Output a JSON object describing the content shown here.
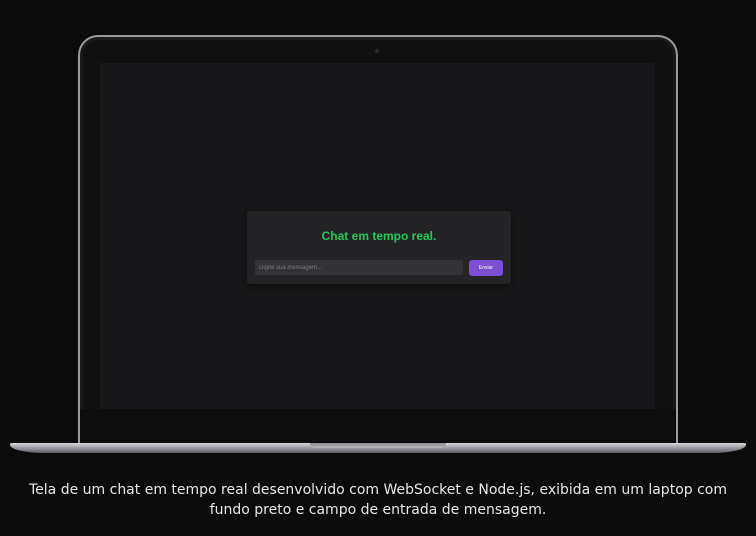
{
  "chat": {
    "title": "Chat em tempo real.",
    "input_placeholder": "Digite sua mensagem...",
    "input_value": "",
    "send_label": "Enviar"
  },
  "caption": "Tela de um chat em tempo real desenvolvido com WebSocket e Node.js, exibida em um laptop com fundo preto e campo de entrada de mensagem.",
  "colors": {
    "background": "#0b0b0c",
    "screen": "#18181a",
    "card": "#242427",
    "title": "#1ec95b",
    "button": "#7b4fd6"
  }
}
